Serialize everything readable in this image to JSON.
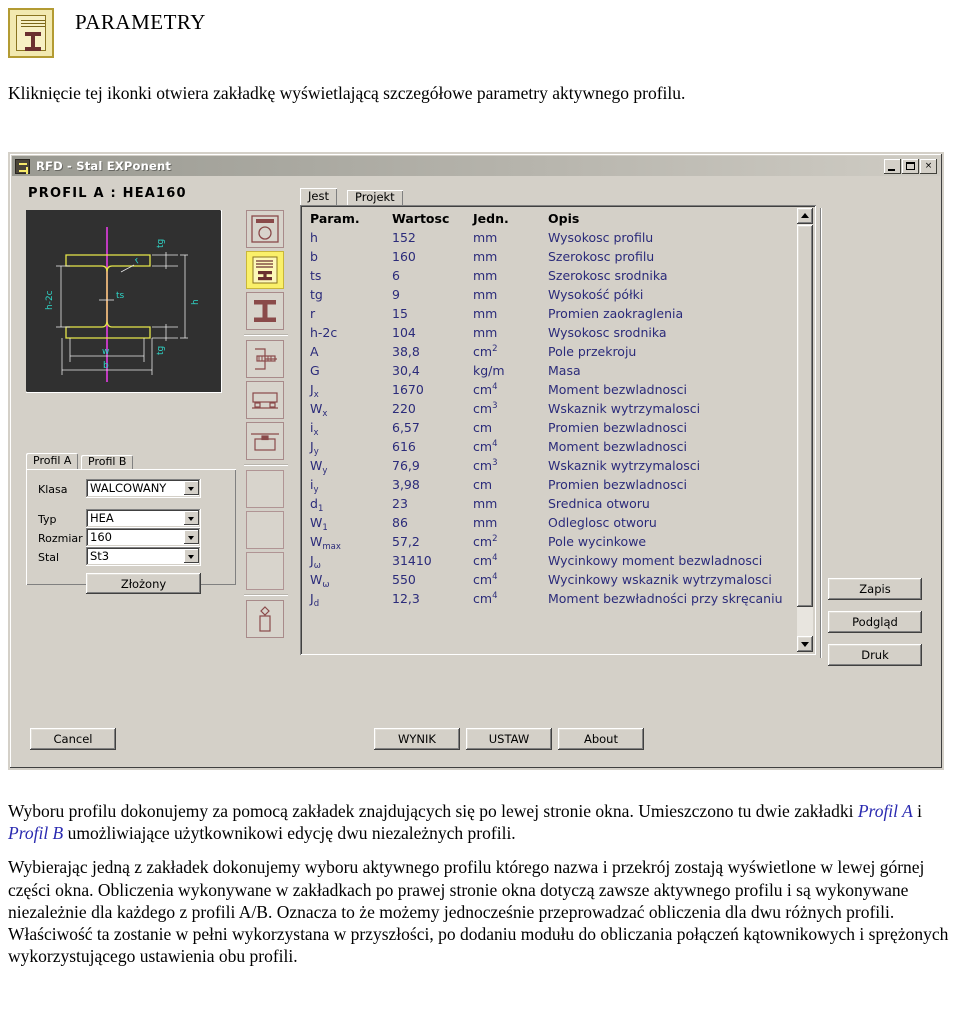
{
  "doc": {
    "title": "PARAMETRY",
    "icon_name": "parametry-icon",
    "lead": "Kliknięcie tej ikonki  otwiera zakładkę wyświetlającą szczegółowe parametry aktywnego profilu.",
    "para1_a": "Wyboru  profilu dokonujemy za pomocą zakładek znajdujących się po lewej stronie okna. Umieszczono tu dwie zakładki ",
    "para1_link1": "Profil A",
    "para1_mid": " i ",
    "para1_link2": "Profil B",
    "para1_b": " umożliwiające użytkownikowi edycję dwu niezależnych profili.",
    "para2": "Wybierając jedną z zakładek dokonujemy wyboru aktywnego profilu którego nazwa i przekrój zostają wyświetlone w lewej górnej części okna. Obliczenia wykonywane w zakładkach po prawej stronie okna dotyczą zawsze aktywnego profilu i są wykonywane niezależnie dla każdego z profili A/B. Oznacza to że możemy jednocześnie przeprowadzać obliczenia dla dwu różnych profili. Właściwość ta zostanie w pełni wykorzystana w przyszłości, po dodaniu modułu do obliczania połączeń kątownikowych i sprężonych wykorzystującego ustawienia obu profili."
  },
  "window": {
    "title": "RFD - Stal EXPonent",
    "minimize": "_",
    "maximize": "□",
    "close": "×",
    "profile_label": "PROFIL  A  :  HEA160"
  },
  "left_panel": {
    "tabs": [
      {
        "label": "Profil A",
        "active": true
      },
      {
        "label": "Profil B",
        "active": false
      }
    ],
    "fields": [
      {
        "label": "Klasa",
        "value": "WALCOWANY"
      },
      {
        "label": "Typ",
        "value": "HEA"
      },
      {
        "label": "Rozmiar",
        "value": "160"
      },
      {
        "label": "Stal",
        "value": "St3"
      }
    ],
    "compound_button": "Złożony"
  },
  "drawing": {
    "labels": [
      "tg",
      "r",
      "h-2c",
      "ts",
      "h",
      "tg",
      "w",
      "b"
    ]
  },
  "toolbar": {
    "icons": [
      {
        "name": "round-section-icon",
        "active": false
      },
      {
        "name": "parameters-icon",
        "active": true
      },
      {
        "name": "i-beam-icon",
        "active": false
      },
      {
        "name": "connection-icon",
        "active": false
      },
      {
        "name": "beam-support-icon",
        "active": false
      },
      {
        "name": "base-plate-icon",
        "active": false
      },
      {
        "name": "empty-slot-1-icon",
        "active": false
      },
      {
        "name": "empty-slot-2-icon",
        "active": false
      },
      {
        "name": "empty-slot-3-icon",
        "active": false
      },
      {
        "name": "column-icon",
        "active": false
      }
    ]
  },
  "right_panel": {
    "tabs": [
      {
        "label": "Jest",
        "active": true
      },
      {
        "label": "Projekt",
        "active": false
      }
    ],
    "headers": {
      "param": "Param.",
      "value": "Wartosc",
      "unit": "Jedn.",
      "desc": "Opis"
    },
    "rows": [
      {
        "param": "h",
        "sub": "",
        "value": "152",
        "unit": "mm",
        "unit_sup": "",
        "desc": "Wysokosc profilu"
      },
      {
        "param": "b",
        "sub": "",
        "value": "160",
        "unit": "mm",
        "unit_sup": "",
        "desc": "Szerokosc profilu"
      },
      {
        "param": "ts",
        "sub": "",
        "value": "6",
        "unit": "mm",
        "unit_sup": "",
        "desc": "Szerokosc srodnika"
      },
      {
        "param": "tg",
        "sub": "",
        "value": "9",
        "unit": "mm",
        "unit_sup": "",
        "desc": "Wysokość półki"
      },
      {
        "param": "r",
        "sub": "",
        "value": "15",
        "unit": "mm",
        "unit_sup": "",
        "desc": "Promien zaokraglenia"
      },
      {
        "param": "h-2c",
        "sub": "",
        "value": "104",
        "unit": "mm",
        "unit_sup": "",
        "desc": "Wysokosc srodnika"
      },
      {
        "param": "A",
        "sub": "",
        "value": "38,8",
        "unit": "cm",
        "unit_sup": "2",
        "desc": "Pole przekroju"
      },
      {
        "param": "G",
        "sub": "",
        "value": "30,4",
        "unit": "kg/m",
        "unit_sup": "",
        "desc": "Masa"
      },
      {
        "param": "J",
        "sub": "x",
        "value": "1670",
        "unit": "cm",
        "unit_sup": "4",
        "desc": "Moment bezwladnosci"
      },
      {
        "param": "W",
        "sub": "x",
        "value": "220",
        "unit": "cm",
        "unit_sup": "3",
        "desc": "Wskaznik wytrzymalosci"
      },
      {
        "param": "i",
        "sub": "x",
        "value": "6,57",
        "unit": "cm",
        "unit_sup": "",
        "desc": "Promien bezwladnosci"
      },
      {
        "param": "J",
        "sub": "y",
        "value": "616",
        "unit": "cm",
        "unit_sup": "4",
        "desc": "Moment bezwladnosci"
      },
      {
        "param": "W",
        "sub": "y",
        "value": "76,9",
        "unit": "cm",
        "unit_sup": "3",
        "desc": "Wskaznik wytrzymalosci"
      },
      {
        "param": "i",
        "sub": "y",
        "value": "3,98",
        "unit": "cm",
        "unit_sup": "",
        "desc": "Promien bezwladnosci"
      },
      {
        "param": "d",
        "sub": "1",
        "value": "23",
        "unit": "mm",
        "unit_sup": "",
        "desc": "Srednica otworu"
      },
      {
        "param": "W",
        "sub": "1",
        "value": "86",
        "unit": "mm",
        "unit_sup": "",
        "desc": "Odleglosc otworu"
      },
      {
        "param": "W",
        "sub": "max",
        "value": "57,2",
        "unit": "cm",
        "unit_sup": "2",
        "desc": "Pole wycinkowe"
      },
      {
        "param": "J",
        "sub": "ω",
        "value": "31410",
        "unit": "cm",
        "unit_sup": "4",
        "desc": "Wycinkowy moment bezwladnosci"
      },
      {
        "param": "W",
        "sub": "ω",
        "value": "550",
        "unit": "cm",
        "unit_sup": "4",
        "desc": "Wycinkowy wskaznik wytrzymalosci"
      },
      {
        "param": "J",
        "sub": "d",
        "value": "12,3",
        "unit": "cm",
        "unit_sup": "4",
        "desc": "Moment bezwładności przy skręcaniu"
      }
    ]
  },
  "side_buttons": [
    {
      "label": "Zapis"
    },
    {
      "label": "Podgląd"
    },
    {
      "label": "Druk"
    }
  ],
  "bottom_buttons": {
    "cancel": "Cancel",
    "wynik": "WYNIK",
    "ustaw": "USTAW",
    "about": "About"
  },
  "colors": {
    "window_face": "#d4d0c8",
    "table_text": "#2b2b7a",
    "active_tool": "#faf06a",
    "link_blue": "#2a2ab0",
    "canvas_bg": "#303030"
  }
}
